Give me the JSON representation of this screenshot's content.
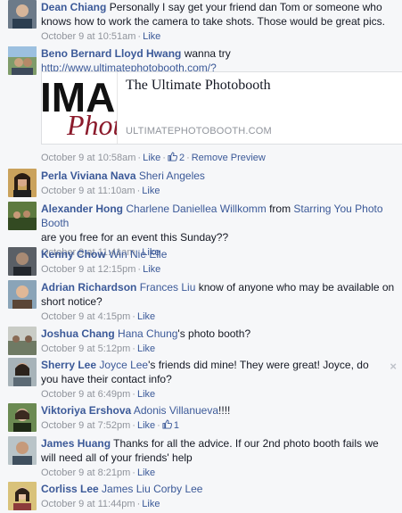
{
  "like_label": "Like",
  "remove_preview_label": "Remove Preview",
  "close_glyph": "×",
  "comments": [
    {
      "author": "Dean Chiang",
      "text": "Personally I say get your friend dan Tom or someone who knows how to work the camera to take shots. Those would be great pics.",
      "time": "October 9 at 10:51am"
    },
    {
      "author": "Beno Bernard Lloyd Hwang",
      "pre": "wanna try ",
      "link": "http://www.ultimatephotobooth.com/?",
      "time": "October 9 at 10:58am",
      "likes": "2",
      "preview": {
        "image_text_big": "IMA",
        "image_text_script": "Phot",
        "title": "The Ultimate Photobooth",
        "domain": "ULTIMATEPHOTOBOOTH.COM"
      }
    },
    {
      "author": "Perla Viviana Nava",
      "mention": "Sheri Angeles",
      "time": "October 9 at 11:10am"
    },
    {
      "author": "Alexander Hong",
      "mention": "Charlene Daniellea Willkomm",
      "mid": " from ",
      "mention2": "Starring You Photo Booth",
      "text": "are you free for an event this Sunday??",
      "time": "October 9 at 11:41am"
    },
    {
      "author": "Kenny Chow",
      "mention": "Win Nie Elle",
      "time": "October 9 at 12:15pm"
    },
    {
      "author": "Adrian Richardson",
      "mention": "Frances Liu",
      "text": " know of anyone who may be available on short notice?",
      "time": "October 9 at 4:15pm"
    },
    {
      "author": "Joshua Chang",
      "mention": "Hana Chung",
      "text": "'s photo booth?",
      "time": "October 9 at 5:12pm"
    },
    {
      "author": "Sherry Lee",
      "mention": "Joyce Lee",
      "text": "'s friends did mine! They were great! Joyce, do you have their contact info?",
      "time": "October 9 at 6:49pm"
    },
    {
      "author": "Viktoriya Ershova",
      "mention": "Adonis Villanueva",
      "text": "!!!!",
      "time": "October 9 at 7:52pm",
      "likes": "1"
    },
    {
      "author": "James Huang",
      "text": "Thanks for all the advice. If our 2nd photo booth fails we will need all of your friends' help",
      "time": "October 9 at 8:21pm"
    },
    {
      "author": "Corliss Lee",
      "mention": "James Liu",
      "mention2": "Corby Lee",
      "time": "October 9 at 11:44pm"
    }
  ],
  "colors": {
    "link": "#3b5998",
    "meta": "#90949c",
    "background": "#f6f7f9"
  }
}
